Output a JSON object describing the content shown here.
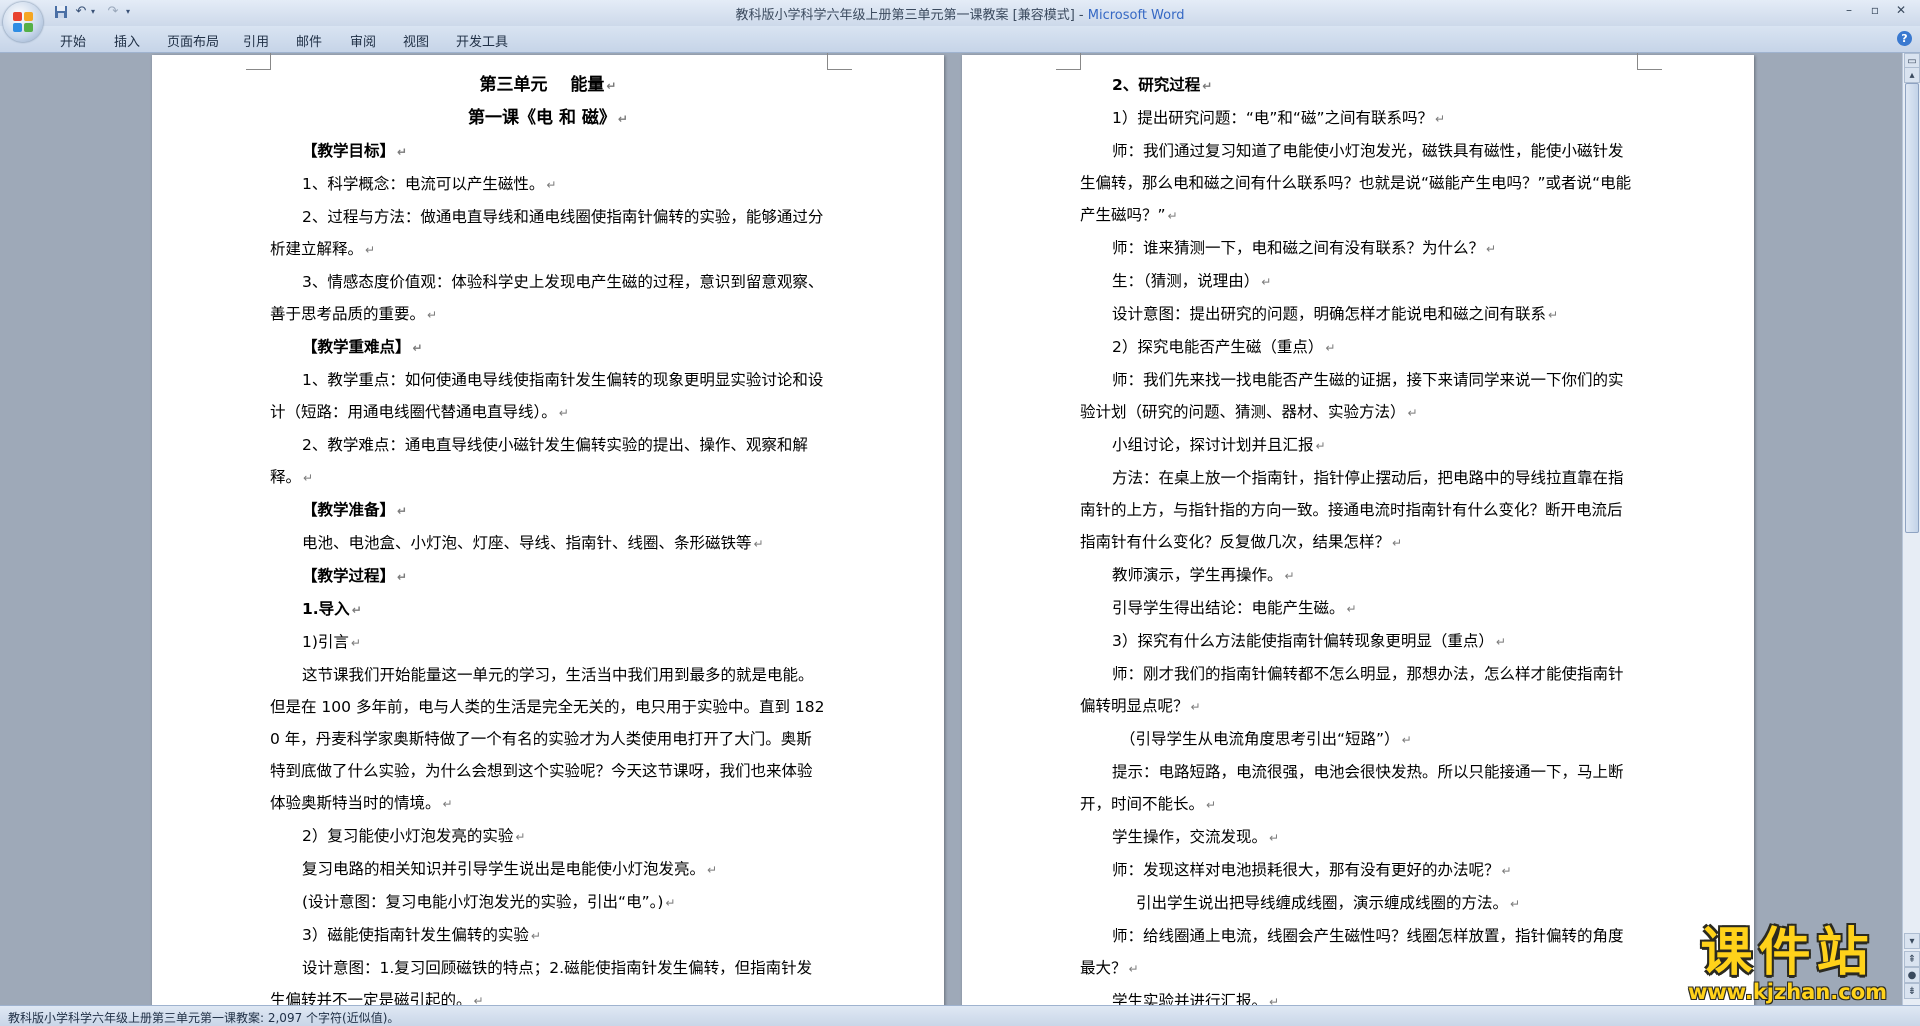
{
  "window": {
    "title_doc": "教科版小学科学六年级上册第三单元第一课教案 [兼容模式] - ",
    "title_app": "Microsoft Word",
    "minimize": "–",
    "maximize": "▫",
    "close": "✕"
  },
  "ribbon": {
    "tabs": [
      "开始",
      "插入",
      "页面布局",
      "引用",
      "邮件",
      "审阅",
      "视图",
      "开发工具"
    ],
    "help": "?"
  },
  "paragraph_mark": "↵",
  "left_page": [
    {
      "style": "center",
      "text": "第三单元　 能量"
    },
    {
      "style": "center",
      "text": "第一课《电 和 磁》"
    },
    {
      "style": "bold ind",
      "text": "【教学目标】"
    },
    {
      "style": "ind",
      "text": "1、科学概念：电流可以产生磁性。"
    },
    {
      "style": "ind",
      "text": "2、过程与方法：做通电直导线和通电线圈使指南针偏转的实验，能够通过分析建立解释。"
    },
    {
      "style": "ind",
      "text": "3、情感态度价值观：体验科学史上发现电产生磁的过程，意识到留意观察、善于思考品质的重要。"
    },
    {
      "style": "bold ind",
      "text": "【教学重难点】"
    },
    {
      "style": "ind",
      "text": "1、教学重点：如何使通电导线使指南针发生偏转的现象更明显实验讨论和设计（短路：用通电线圈代替通电直导线）。"
    },
    {
      "style": "ind",
      "text": "2、教学难点：通电直导线使小磁针发生偏转实验的提出、操作、观察和解释。"
    },
    {
      "style": "bold ind",
      "text": "【教学准备】"
    },
    {
      "style": "ind",
      "text": "电池、电池盒、小灯泡、灯座、导线、指南针、线圈、条形磁铁等"
    },
    {
      "style": "bold ind",
      "text": "【教学过程】"
    },
    {
      "style": "bold ind",
      "text": "1.导入"
    },
    {
      "style": "ind",
      "text": "1)引言"
    },
    {
      "style": "ind",
      "text": "这节课我们开始能量这一单元的学习，生活当中我们用到最多的就是电能。但是在 100 多年前，电与人类的生活是完全无关的，电只用于实验中。直到 1820 年，丹麦科学家奥斯特做了一个有名的实验才为人类使用电打开了大门。奥斯特到底做了什么实验，为什么会想到这个实验呢？今天这节课呀，我们也来体验体验奥斯特当时的情境。"
    },
    {
      "style": "ind",
      "text": "2）复习能使小灯泡发亮的实验"
    },
    {
      "style": "ind",
      "text": "复习电路的相关知识并引导学生说出是电能使小灯泡发亮。"
    },
    {
      "style": "ind",
      "text": "(设计意图：复习电能小灯泡发光的实验，引出“电”。)"
    },
    {
      "style": "ind",
      "text": "3）磁能使指南针发生偏转的实验"
    },
    {
      "style": "ind",
      "text": "设计意图：1.复习回顾磁铁的特点；2.磁能使指南针发生偏转，但指南针发生偏转并不一定是磁引起的。"
    }
  ],
  "right_page": [
    {
      "style": "bold ind",
      "text": "2、研究过程"
    },
    {
      "style": "ind",
      "text": "1）提出研究问题：“电”和“磁”之间有联系吗？"
    },
    {
      "style": "ind",
      "text": "师：我们通过复习知道了电能使小灯泡发光，磁铁具有磁性，能使小磁针发生偏转，那么电和磁之间有什么联系吗？也就是说“磁能产生电吗？”或者说“电能产生磁吗？”"
    },
    {
      "style": "ind",
      "text": "师：谁来猜测一下，电和磁之间有没有联系？为什么？"
    },
    {
      "style": "ind",
      "text": "生：（猜测，说理由）"
    },
    {
      "style": "ind",
      "text": "设计意图：提出研究的问题，明确怎样才能说电和磁之间有联系"
    },
    {
      "style": "ind",
      "text": "2）探究电能否产生磁（重点）"
    },
    {
      "style": "ind",
      "text": "师：我们先来找一找电能否产生磁的证据，接下来请同学来说一下你们的实验计划（研究的问题、猜测、器材、实验方法）"
    },
    {
      "style": "ind",
      "text": "小组讨论，探讨计划并且汇报"
    },
    {
      "style": "ind",
      "text": "方法：在桌上放一个指南针，指针停止摆动后，把电路中的导线拉直靠在指南针的上方，与指针指的方向一致。接通电流时指南针有什么变化？断开电流后指南针有什么变化？反复做几次，结果怎样？"
    },
    {
      "style": "ind",
      "text": "教师演示，学生再操作。"
    },
    {
      "style": "ind",
      "text": "引导学生得出结论：电能产生磁。"
    },
    {
      "style": "ind",
      "text": "3）探究有什么方法能使指南针偏转现象更明显（重点）"
    },
    {
      "style": "ind",
      "text": "师：刚才我们的指南针偏转都不怎么明显，那想办法，怎么样才能使指南针偏转明显点呢？"
    },
    {
      "style": "ind-small",
      "text": "（引导学生从电流角度思考引出“短路”）"
    },
    {
      "style": "ind",
      "text": "提示：电路短路，电流很强，电池会很快发热。所以只能接通一下，马上断开，时间不能长。"
    },
    {
      "style": "ind",
      "text": "学生操作，交流发现。"
    },
    {
      "style": "ind",
      "text": "师：发现这样对电池损耗很大，那有没有更好的办法呢？"
    },
    {
      "style": "ind-big",
      "text": "引出学生说出把导线缠成线圈，演示缠成线圈的方法。"
    },
    {
      "style": "ind",
      "text": "师：给线圈通上电流，线圈会产生磁性吗？线圈怎样放置，指针偏转的角度最大？"
    },
    {
      "style": "ind",
      "text": "学生实验并进行汇报。"
    }
  ],
  "status": {
    "text": "教科版小学科学六年级上册第三单元第一课教案: 2,097 个字符(近似值)。"
  },
  "watermark": {
    "cn": "课件站",
    "url": "www.kjzhan.com"
  },
  "colors": {
    "office_logo": [
      "#e8432f",
      "#f5a623",
      "#2f8de4",
      "#55b047"
    ],
    "word_app_name": "#3568c4",
    "watermark": "#ffd21a"
  }
}
